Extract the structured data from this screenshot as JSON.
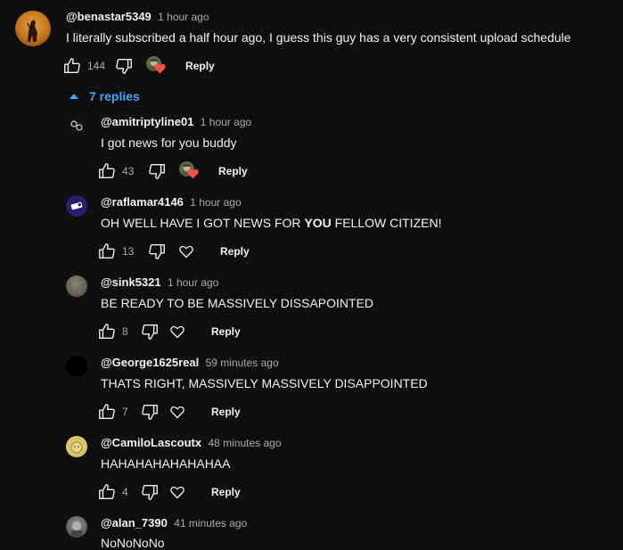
{
  "top_comment": {
    "handle": "@benastar5349",
    "time": "1 hour ago",
    "text": "I literally subscribed a half hour ago, I guess this guy has a very consistent upload schedule",
    "likes": "144",
    "reply_label": "Reply",
    "creator_hearted": true
  },
  "replies_toggle": {
    "label": "7 replies",
    "expanded": true
  },
  "replies": [
    {
      "handle": "@amitriptyline01",
      "time": "1 hour ago",
      "text": "I got news for you buddy",
      "likes": "43",
      "reply_label": "Reply",
      "creator_hearted": true,
      "avatar_color": "#111111"
    },
    {
      "handle": "@raflamar4146",
      "time": "1 hour ago",
      "text_parts": [
        "OH WELL HAVE I GOT NEWS FOR ",
        "YOU",
        " FELLOW CITIZEN!"
      ],
      "likes": "13",
      "reply_label": "Reply",
      "creator_hearted": false,
      "avatar_color": "#2a1e6e"
    },
    {
      "handle": "@sink5321",
      "time": "1 hour ago",
      "text": "BE READY TO BE MASSIVELY DISSAPOINTED",
      "likes": "8",
      "reply_label": "Reply",
      "creator_hearted": false,
      "avatar_color": "#6e6a5e"
    },
    {
      "handle": "@George1625real",
      "time": "59 minutes ago",
      "text": "THATS RIGHT, MASSIVELY MASSIVELY DISAPPOINTED",
      "likes": "7",
      "reply_label": "Reply",
      "creator_hearted": false,
      "avatar_color": "#000000"
    },
    {
      "handle": "@CamiloLascoutx",
      "time": "48 minutes ago",
      "text": "HAHAHAHAHAHAHAA",
      "likes": "4",
      "reply_label": "Reply",
      "creator_hearted": false,
      "avatar_color": "#d8c46a"
    },
    {
      "handle": "@alan_7390",
      "time": "41 minutes ago",
      "text": "NoNoNoNo",
      "avatar_color": "#7a7a7a"
    }
  ],
  "icons": {
    "like": "thumbs-up-icon",
    "dislike": "thumbs-down-icon",
    "heart": "heart-outline-icon",
    "creator_heart": "creator-heart-icon",
    "expand": "triangle-up-icon"
  },
  "colors": {
    "background": "#0f0f0f",
    "link": "#3ea6ff",
    "muted": "#aaaaaa",
    "heart": "#ff4e45"
  }
}
